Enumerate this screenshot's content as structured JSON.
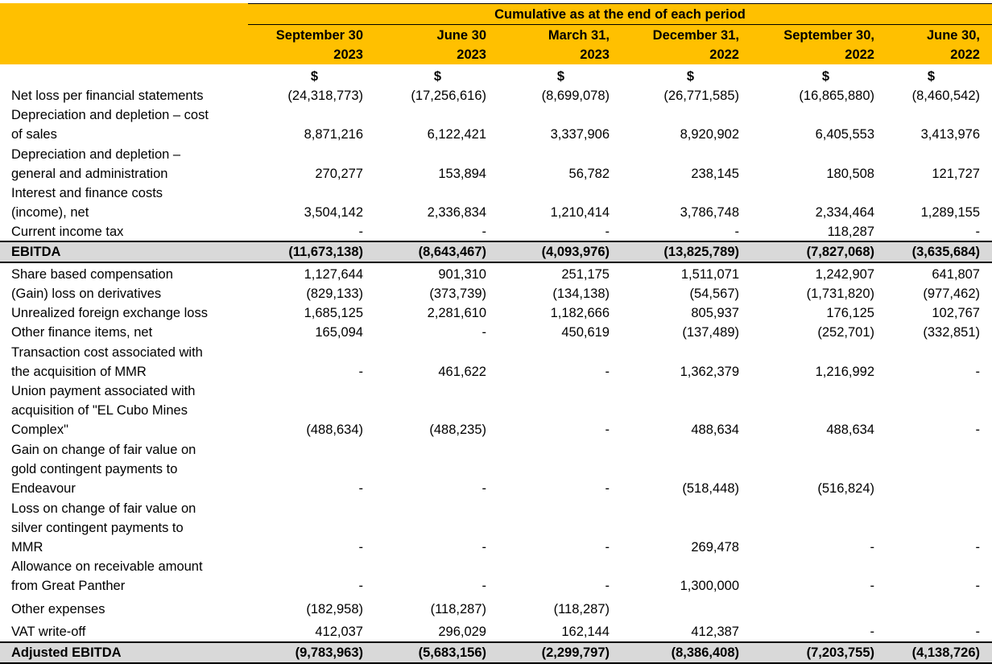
{
  "header": {
    "group_title": "Cumulative as at the end of each period",
    "columns": [
      {
        "line1": "September 30",
        "line2": "2023"
      },
      {
        "line1": "June 30",
        "line2": "2023"
      },
      {
        "line1": "March 31,",
        "line2": "2023"
      },
      {
        "line1": "December 31,",
        "line2": "2022"
      },
      {
        "line1": "September 30,",
        "line2": "2022"
      },
      {
        "line1": "June 30,",
        "line2": "2022"
      }
    ],
    "currency": [
      "$",
      "$",
      "$",
      "$",
      "$",
      "$"
    ]
  },
  "rows": [
    {
      "label": [
        "Net loss per financial statements"
      ],
      "values": [
        "(24,318,773)",
        "(17,256,616)",
        "(8,699,078)",
        "(26,771,585)",
        "(16,865,880)",
        "(8,460,542)"
      ]
    },
    {
      "label": [
        "Depreciation and depletion – cost",
        "of sales"
      ],
      "values": [
        "8,871,216",
        "6,122,421",
        "3,337,906",
        "8,920,902",
        "6,405,553",
        "3,413,976"
      ]
    },
    {
      "label": [
        "Depreciation and depletion –",
        "general and administration"
      ],
      "values": [
        "270,277",
        "153,894",
        "56,782",
        "238,145",
        "180,508",
        "121,727"
      ]
    },
    {
      "label": [
        "Interest and finance costs",
        "(income), net"
      ],
      "values": [
        "3,504,142",
        "2,336,834",
        "1,210,414",
        "3,786,748",
        "2,334,464",
        "1,289,155"
      ]
    },
    {
      "label": [
        "Current income tax"
      ],
      "values": [
        "-",
        "-",
        "-",
        "-",
        "118,287",
        "-"
      ]
    },
    {
      "label": [
        "EBITDA"
      ],
      "values": [
        "(11,673,138)",
        "(8,643,467)",
        "(4,093,976)",
        "(13,825,789)",
        "(7,827,068)",
        "(3,635,684)"
      ],
      "total": true
    },
    {
      "label": [
        "Share based compensation"
      ],
      "values": [
        "1,127,644",
        "901,310",
        "251,175",
        "1,511,071",
        "1,242,907",
        "641,807"
      ]
    },
    {
      "label": [
        "(Gain) loss on derivatives"
      ],
      "values": [
        "(829,133)",
        "(373,739)",
        "(134,138)",
        "(54,567)",
        "(1,731,820)",
        "(977,462)"
      ]
    },
    {
      "label": [
        "Unrealized foreign exchange loss"
      ],
      "values": [
        "1,685,125",
        "2,281,610",
        "1,182,666",
        "805,937",
        "176,125",
        "102,767"
      ]
    },
    {
      "label": [
        "Other finance items, net"
      ],
      "values": [
        "165,094",
        "-",
        "450,619",
        "(137,489)",
        "(252,701)",
        "(332,851)"
      ]
    },
    {
      "label": [
        "Transaction cost associated with",
        "the acquisition of MMR"
      ],
      "values": [
        "-",
        "461,622",
        "-",
        "1,362,379",
        "1,216,992",
        "-"
      ]
    },
    {
      "label": [
        "Union payment associated with",
        "acquisition of \"EL Cubo Mines",
        "Complex\""
      ],
      "values": [
        "(488,634)",
        "(488,235)",
        "-",
        "488,634",
        "488,634",
        "-"
      ]
    },
    {
      "label": [
        "Gain on change of fair value on",
        "gold contingent payments to",
        "Endeavour"
      ],
      "values": [
        "-",
        "-",
        "-",
        "(518,448)",
        "(516,824)",
        ""
      ]
    },
    {
      "label": [
        "Loss on change of fair value on",
        "silver contingent payments to",
        "MMR"
      ],
      "values": [
        "-",
        "-",
        "-",
        "269,478",
        "-",
        "-"
      ]
    },
    {
      "label": [
        "Allowance on receivable amount",
        "from Great Panther"
      ],
      "values": [
        "-",
        "-",
        "-",
        "1,300,000",
        "-",
        "-"
      ]
    },
    {
      "label": [
        "Other expenses"
      ],
      "values": [
        "(182,958)",
        "(118,287)",
        "(118,287)",
        "",
        "",
        ""
      ]
    },
    {
      "label": [
        "VAT write-off"
      ],
      "values": [
        "412,037",
        "296,029",
        "162,144",
        "412,387",
        "-",
        "-"
      ]
    },
    {
      "label": [
        "Adjusted EBITDA"
      ],
      "values": [
        "(9,783,963)",
        "(5,683,156)",
        "(2,299,797)",
        "(8,386,408)",
        "(7,203,755)",
        "(4,138,726)"
      ],
      "total": true
    }
  ]
}
